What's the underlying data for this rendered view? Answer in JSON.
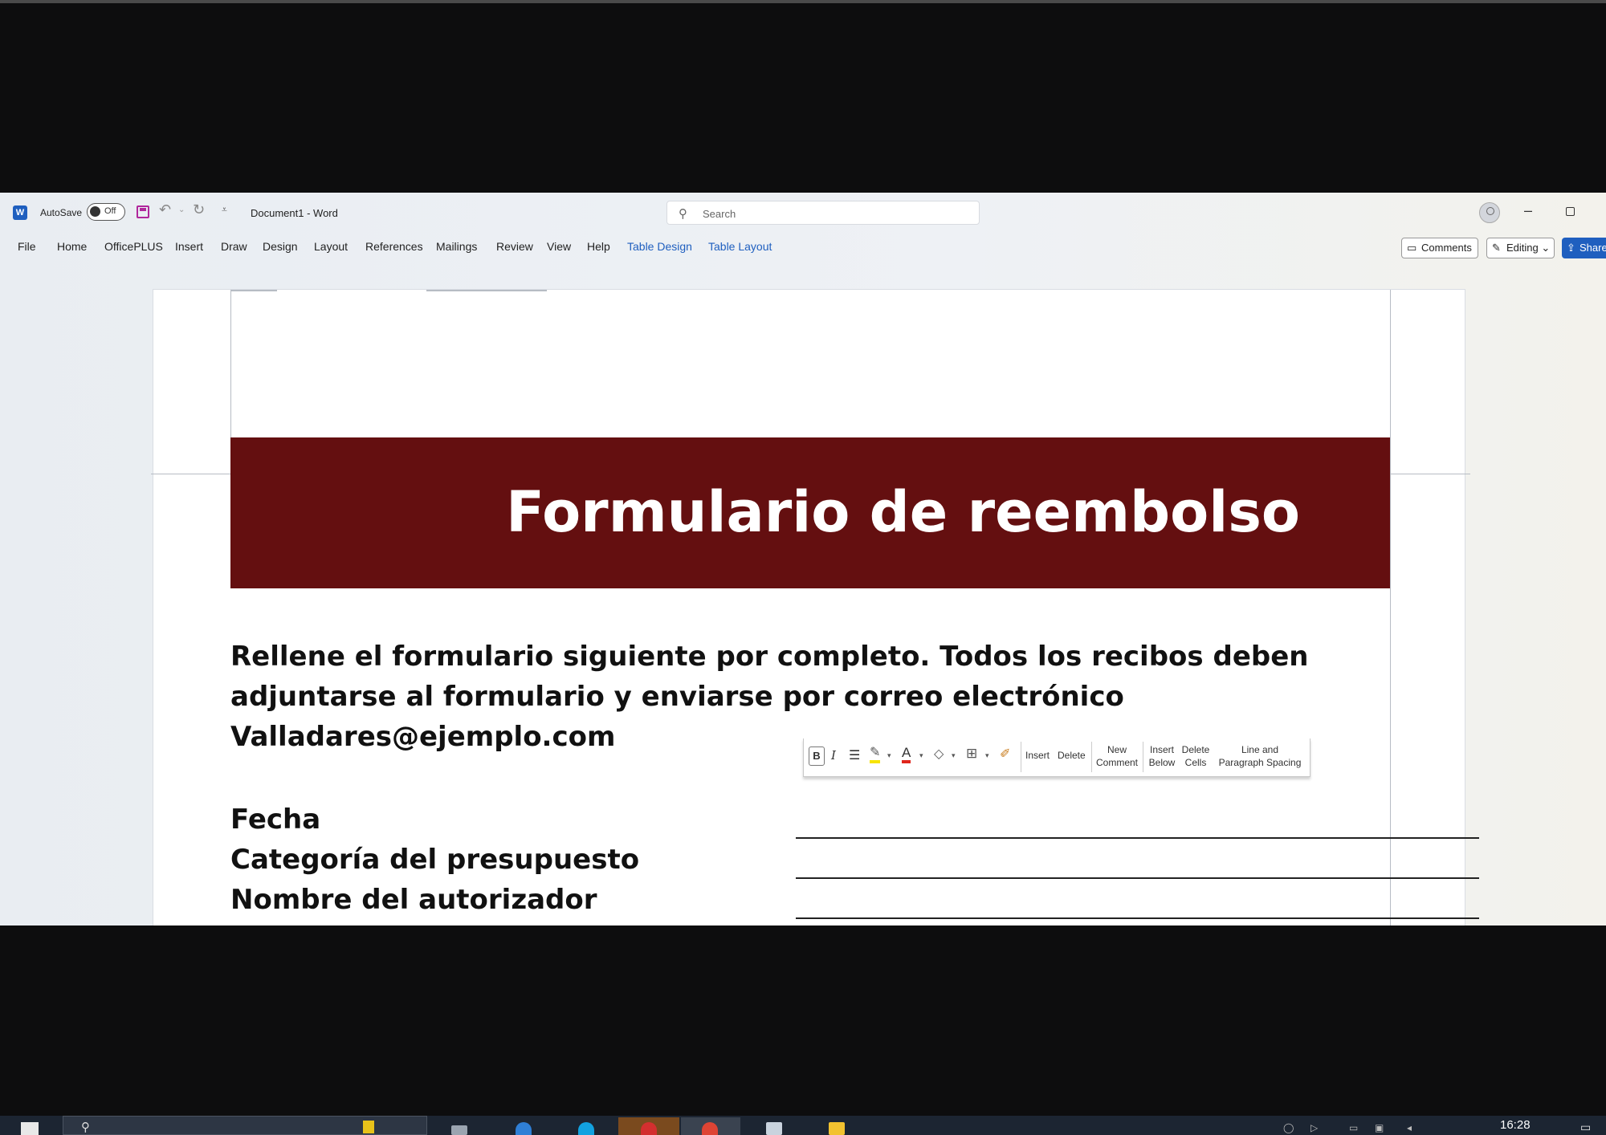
{
  "window": {
    "autosave_label": "AutoSave",
    "autosave_state": "Off",
    "doc_title": "Document1 - Word",
    "search_placeholder": "Search"
  },
  "menu": {
    "tabs": [
      "File",
      "Home",
      "OfficePLUS",
      "Insert",
      "Draw",
      "Design",
      "Layout",
      "References",
      "Mailings",
      "Review",
      "View",
      "Help"
    ],
    "context_tabs": [
      "Table Design",
      "Table Layout"
    ],
    "comments_label": "Comments",
    "editing_label": "Editing",
    "share_label": "Share"
  },
  "document": {
    "banner_title": "Formulario de reembolso",
    "intro_lines": [
      "Rellene el formulario siguiente por completo. Todos los recibos deben",
      "adjuntarse al formulario y enviarse por correo electrónico",
      "Valladares@ejemplo.com"
    ],
    "fields": [
      "Fecha",
      "Categoría del presupuesto",
      "Nombre del autorizador"
    ],
    "banner_color": "#640f10"
  },
  "mini_toolbar": {
    "bold": "B",
    "italic": "I",
    "insert": "Insert",
    "delete": "Delete",
    "new_comment": [
      "New",
      "Comment"
    ],
    "insert_below": [
      "Insert",
      "Below"
    ],
    "delete_cells": [
      "Delete",
      "Cells"
    ],
    "line_spacing": [
      "Line and",
      "Paragraph Spacing"
    ]
  },
  "taskbar": {
    "time": "16:28"
  }
}
